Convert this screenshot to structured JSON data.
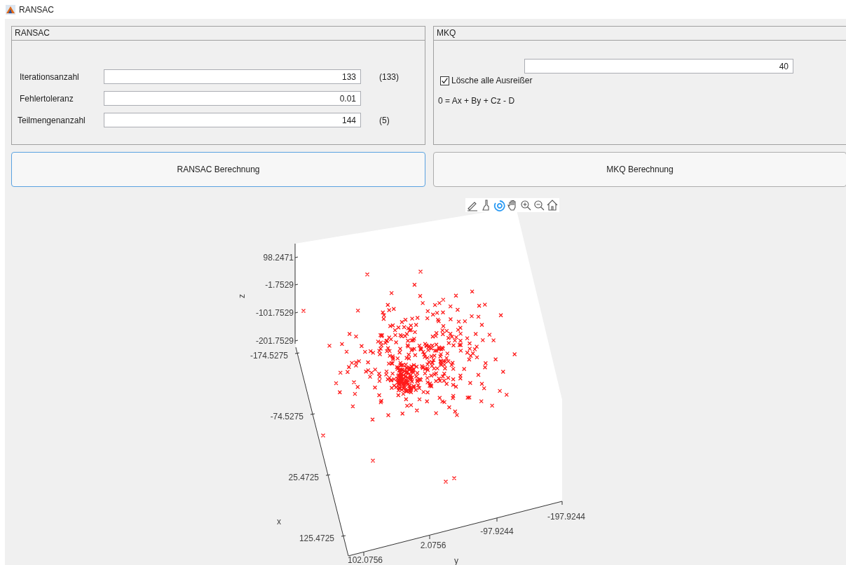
{
  "window": {
    "title": "RANSAC"
  },
  "ransac_panel": {
    "title": "RANSAC",
    "fields": [
      {
        "label": "Iterationsanzahl",
        "value": "133",
        "note": "(133)"
      },
      {
        "label": "Fehlertoleranz",
        "value": "0.01"
      },
      {
        "label": "Teilmengenanzahl",
        "value": "144",
        "note": "(5)"
      }
    ]
  },
  "mkq_panel": {
    "title": "MKQ",
    "value": "40",
    "checkbox": {
      "label": "Lösche alle Ausreißer",
      "checked": true
    },
    "equation": "0 = Ax + By + Cz - D"
  },
  "buttons": [
    {
      "label": "RANSAC Berechnung",
      "focused": true
    },
    {
      "label": "MKQ Berechnung",
      "focused": false
    }
  ],
  "plot": {
    "toolbar": [
      {
        "kind": "data-tips",
        "selected": false
      },
      {
        "kind": "brush",
        "selected": false
      },
      {
        "kind": "rotate",
        "selected": true
      },
      {
        "kind": "pan",
        "selected": false
      },
      {
        "kind": "zoom-in",
        "selected": false
      },
      {
        "kind": "zoom-out",
        "selected": false
      },
      {
        "kind": "home",
        "selected": false
      }
    ],
    "z_label": "z",
    "z_ticks": [
      "98.2471",
      "-1.7529",
      "-101.7529",
      "-201.7529"
    ],
    "x_label": "x",
    "x_ticks": [
      "-174.5275",
      "-74.5275",
      "25.4725",
      "125.4725"
    ],
    "y_label": "y",
    "y_ticks": [
      "102.0756",
      "2.0756",
      "-97.9244",
      "-197.9244"
    ]
  }
}
